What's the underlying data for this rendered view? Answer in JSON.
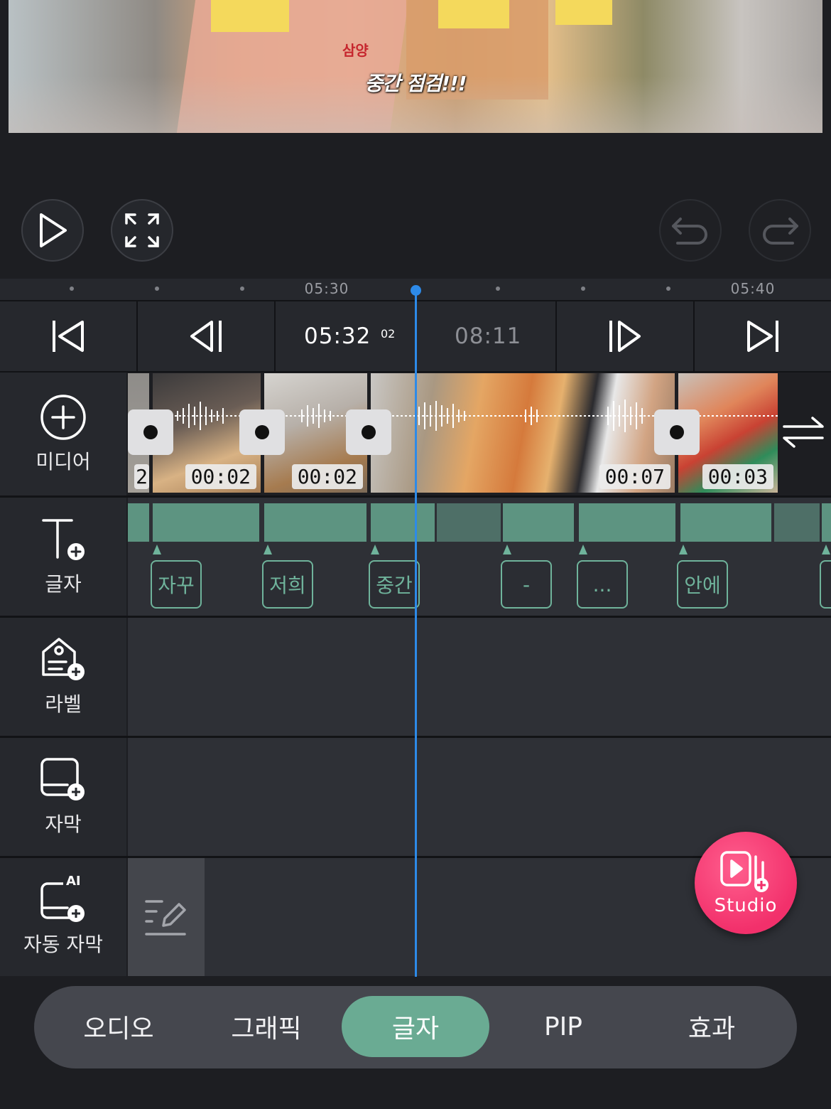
{
  "preview": {
    "caption": "중간 점검!!!",
    "brand_text": "삼양"
  },
  "toolbar": {
    "play": "play-icon",
    "fullscreen": "fullscreen-icon",
    "undo": "undo-icon",
    "redo": "redo-icon"
  },
  "ruler": {
    "labels": [
      "05:30",
      "05:40"
    ]
  },
  "navigation": {
    "current_time": "05:32",
    "current_frame": "02",
    "total_time": "08:11"
  },
  "tracks": {
    "media": {
      "label": "미디어",
      "icon": "add-circle-icon"
    },
    "text": {
      "label": "글자",
      "icon": "text-add-icon"
    },
    "label": {
      "label": "라벨",
      "icon": "label-add-icon"
    },
    "subtitle": {
      "label": "자막",
      "icon": "subtitle-add-icon"
    },
    "auto_subtitle": {
      "label": "자동 자막",
      "icon": "ai-subtitle-icon",
      "badge": "AI"
    }
  },
  "clips": {
    "partial_first": "2",
    "durations": [
      "00:02",
      "00:02",
      "00:07",
      "00:03"
    ]
  },
  "text_chips": [
    "자꾸",
    "저희",
    "중간",
    "-",
    "...",
    "안에"
  ],
  "studio": {
    "label": "Studio"
  },
  "tabs": {
    "audio": "오디오",
    "graphic": "그래픽",
    "text": "글자",
    "pip": "PIP",
    "effect": "효과",
    "active": "text"
  },
  "colors": {
    "accent_green": "#6aab93",
    "playhead_blue": "#2d8ae8",
    "studio_pink": "#f2306b"
  }
}
